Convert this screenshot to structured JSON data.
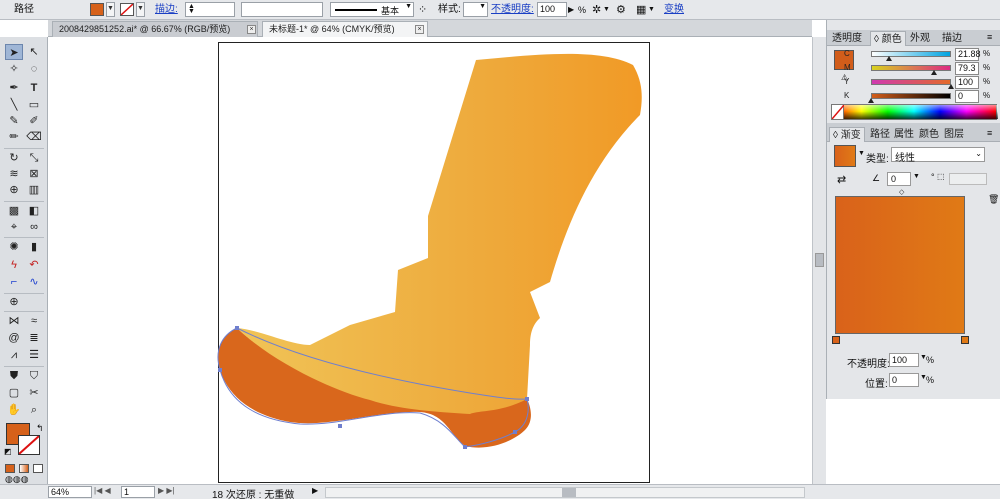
{
  "control_bar": {
    "object_type": "路径",
    "stroke_label": "描边:",
    "stroke_weight": "",
    "brush_name": "基本",
    "style_label": "样式:",
    "opacity_label": "不透明度:",
    "opacity_value": "100",
    "opacity_unit": "%",
    "transform_label": "变换",
    "fill_color": "#d6611a"
  },
  "tabs": [
    {
      "label": "2008429851252.ai* @ 66.67% (RGB/预览)"
    },
    {
      "label": "未标题-1* @ 64% (CMYK/预览)"
    }
  ],
  "tools": {
    "fill_color": "#d6611a"
  },
  "color_panel": {
    "tabs": [
      "透明度",
      "颜色",
      "外观",
      "描边"
    ],
    "active_tab": "颜色",
    "swatch_color": "#d25d1a",
    "channels": [
      {
        "name": "C",
        "value": "21.88",
        "fraction": 0.2188,
        "colors": [
          "#ffffff",
          "#00a3e0"
        ]
      },
      {
        "name": "M",
        "value": "79.3",
        "fraction": 0.793,
        "colors": [
          "#d8d21f",
          "#dd2a83"
        ]
      },
      {
        "name": "Y",
        "value": "100",
        "fraction": 1.0,
        "colors": [
          "#cf3ab0",
          "#e36a2a"
        ]
      },
      {
        "name": "K",
        "value": "0",
        "fraction": 0.0,
        "colors": [
          "#d25d1a",
          "#000000"
        ]
      }
    ]
  },
  "gradient_panel": {
    "tabs": [
      "渐变",
      "路径",
      "属性",
      "颜色",
      "图层"
    ],
    "active_tab": "渐变",
    "type_label": "类型:",
    "type_value": "线性",
    "angle_value": "0",
    "angle_unit": "°",
    "opacity_label": "不透明度:",
    "opacity_value": "100",
    "location_label": "位置:",
    "location_value": "0",
    "percent": "%",
    "stops": [
      {
        "location": 0,
        "color": "#d9621a"
      },
      {
        "location": 100,
        "color": "#e07a16"
      }
    ]
  },
  "status_bar": {
    "zoom": "64%",
    "page": "1",
    "message": "18 次还原 : 无重做"
  },
  "artwork": {
    "boot_gradient": [
      "#f0c457",
      "#eeaa3c",
      "#f19a26"
    ],
    "sole_color": "#d9671c",
    "path_color": "#6f7fce"
  }
}
